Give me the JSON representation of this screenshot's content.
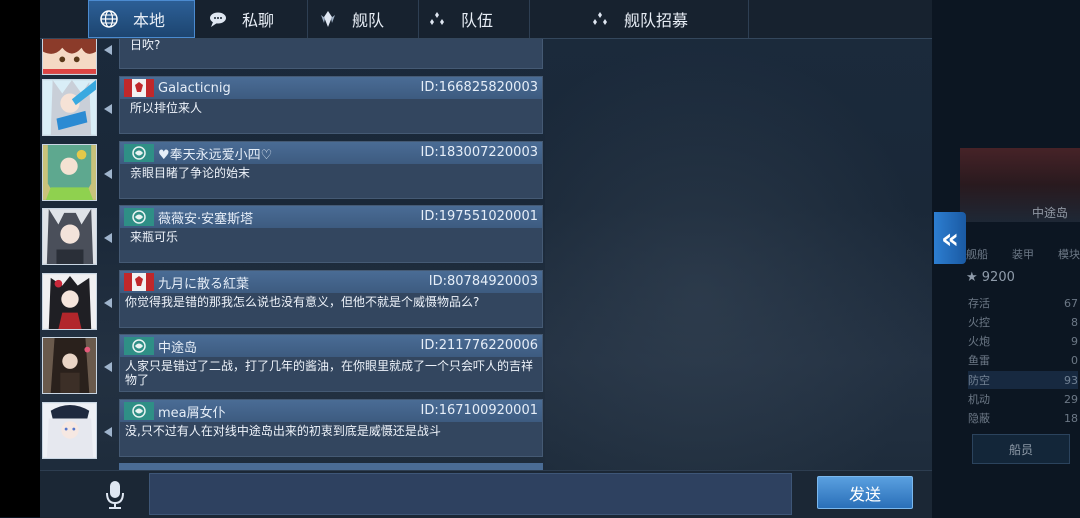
{
  "tabs": [
    {
      "label": "本地",
      "icon": "globe-icon",
      "active": true
    },
    {
      "label": "私聊",
      "icon": "chat-bubble-icon",
      "active": false
    },
    {
      "label": "舰队",
      "icon": "fleet-emblem-icon",
      "active": false
    },
    {
      "label": "队伍",
      "icon": "team-dots-icon",
      "active": false
    },
    {
      "label": "舰队招募",
      "icon": "team-dots-icon",
      "active": false
    }
  ],
  "partial_message": {
    "text": "日吹?"
  },
  "messages": [
    {
      "name": "Galacticnig",
      "id": "ID:166825820003",
      "text": "所以排位来人",
      "flag": "red-flag-icon"
    },
    {
      "name": "♥奉天永远爱小四♡",
      "id": "ID:183007220003",
      "text": "亲眼目睹了争论的始末",
      "flag": "green-emblem-icon"
    },
    {
      "name": "薇薇安·安塞斯塔",
      "id": "ID:197551020001",
      "text": "来瓶可乐",
      "flag": "green-emblem-icon"
    },
    {
      "name": "九月に散る紅葉",
      "id": "ID:80784920003",
      "text": "你觉得我是错的那我怎么说也没有意义，但他不就是个威慑物品么?",
      "flag": "red-flag-icon"
    },
    {
      "name": "中途岛",
      "id": "ID:211776220006",
      "text": "人家只是错过了二战，打了几年的酱油，在你眼里就成了一个只会吓人的吉祥物了",
      "flag": "green-emblem-icon"
    },
    {
      "name": "mea屑女仆",
      "id": "ID:167100920001",
      "text": "没,只不过有人在对线中途岛出来的初衷到底是威慑还是战斗",
      "flag": "green-emblem-icon"
    }
  ],
  "input": {
    "placeholder": ""
  },
  "send_label": "发送",
  "collapse_icon": "double-chevron-left-icon",
  "side": {
    "ship_name": "中途岛",
    "labels": [
      "舰船",
      "装甲",
      "模块"
    ],
    "rating": "★ 9200",
    "stats": [
      {
        "label": "存活",
        "value": "67"
      },
      {
        "label": "火控",
        "value": "8"
      },
      {
        "label": "火炮",
        "value": "9"
      },
      {
        "label": "鱼雷",
        "value": "0"
      },
      {
        "label": "防空",
        "value": "93"
      },
      {
        "label": "机动",
        "value": "29"
      },
      {
        "label": "隐蔽",
        "value": "18"
      }
    ],
    "crew_label": "船员"
  },
  "colors": {
    "tab_active": "#2c5f96",
    "bubble_header": "#4a6c95",
    "bubble_body": "#33465f",
    "send_button": "#2a6fb8"
  }
}
